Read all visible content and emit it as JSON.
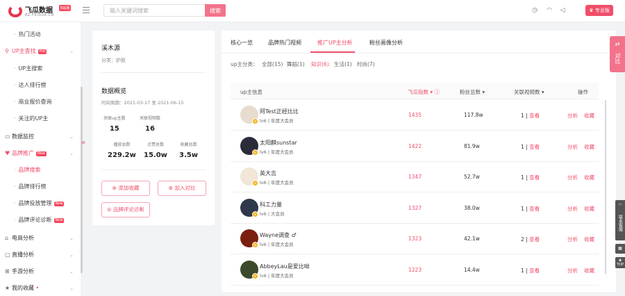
{
  "brand": {
    "name": "飞瓜数据",
    "badge": "B站版",
    "domain": "BZ.FEIGUA.CN"
  },
  "search": {
    "placeholder": "输入关键词搜索",
    "button": "搜索"
  },
  "pro_label": "专业版",
  "sidebar": [
    {
      "label": "热门活动",
      "type": "sub"
    },
    {
      "label": "UP主查找",
      "type": "top",
      "badge": "Hot",
      "active": true,
      "icon": "search-icon"
    },
    {
      "label": "UP主搜索",
      "type": "sub"
    },
    {
      "label": "达人排行榜",
      "type": "sub"
    },
    {
      "label": "商业报价查询",
      "type": "sub"
    },
    {
      "label": "关注的UP主",
      "type": "sub"
    },
    {
      "label": "数据监控",
      "type": "top",
      "icon": "monitor-icon"
    },
    {
      "label": "品牌推广",
      "type": "top",
      "badge": "New",
      "active": true,
      "icon": "heart-icon"
    },
    {
      "label": "品牌搜索",
      "type": "sub",
      "active": true
    },
    {
      "label": "品牌排行榜",
      "type": "sub"
    },
    {
      "label": "品牌投放管理",
      "type": "sub",
      "badge": "New"
    },
    {
      "label": "品牌评论诊断",
      "type": "sub",
      "badge": "New"
    },
    {
      "label": "电商分析",
      "type": "top",
      "icon": "shop-icon"
    },
    {
      "label": "直播分析",
      "type": "top",
      "icon": "live-icon"
    },
    {
      "label": "手游分析",
      "type": "top",
      "icon": "gamepad-icon"
    },
    {
      "label": "我的收藏",
      "type": "top",
      "icon": "star-icon",
      "dot": "•"
    }
  ],
  "brand_card": {
    "name": "溪木源",
    "category": "分类：护肤",
    "overview_title": "数据概览",
    "date_range": "时间周期：2021-03-17 至 2021-06-15",
    "stats": [
      {
        "label": "关联up主数",
        "value": "15"
      },
      {
        "label": "关联视频数",
        "value": "16"
      },
      {
        "label": "播放总数",
        "value": "229.2w"
      },
      {
        "label": "点赞总数",
        "value": "15.0w"
      },
      {
        "label": "收藏总数",
        "value": "3.5w"
      }
    ],
    "buttons": {
      "collect": "添加收藏",
      "compare": "加入对比",
      "diagnose": "品牌评论诊断"
    }
  },
  "tabs": [
    "核心一览",
    "品牌热门视频",
    "推广UP主分析",
    "粉丝画像分析"
  ],
  "filter": {
    "label": "up主分类：",
    "items": [
      "全部(15)",
      "舞蹈(1)",
      "知识(6)",
      "生活(1)",
      "时尚(7)"
    ]
  },
  "table": {
    "headers": {
      "info": "up主信息",
      "fg": "飞瓜指数",
      "fans": "粉丝总数",
      "rel": "关联视频数",
      "ops": "操作"
    },
    "rows": [
      {
        "name": "阿Test正经比比",
        "lv": "lv6 | 年度大会员",
        "fg": "1435",
        "fans": "117.8w",
        "rel": "1",
        "look": "查看",
        "av": "#e8dcd0"
      },
      {
        "name": "太阳麒sunstar",
        "lv": "lv6 | 年度大会员",
        "fg": "1422",
        "fans": "81.9w",
        "rel": "1",
        "look": "查看",
        "av": "#2b2b3a"
      },
      {
        "name": "英大吉",
        "lv": "lv6 | 年度大会员",
        "fg": "1347",
        "fans": "52.7w",
        "rel": "1",
        "look": "查看",
        "av": "#f2e6d8"
      },
      {
        "name": "科工力量",
        "lv": "lv6 | 大会员",
        "fg": "1327",
        "fans": "38.0w",
        "rel": "1",
        "look": "查看",
        "av": "#2e3a4a"
      },
      {
        "name": "Wayne调查 ♂",
        "lv": "lv6 | 年度大会员",
        "fg": "1323",
        "fans": "42.1w",
        "rel": "2",
        "look": "查看",
        "av": "#7a1f10"
      },
      {
        "name": "AbbeyLau是爱比呦",
        "lv": "lv6 | 年度大会员",
        "fg": "1223",
        "fans": "14.4w",
        "rel": "1",
        "look": "查看",
        "av": "#3a4a2a"
      }
    ],
    "actions": {
      "analyze": "分析",
      "collect": "收藏"
    }
  },
  "float": {
    "compare": "对比",
    "service": "联系客服",
    "top": "TOP"
  }
}
